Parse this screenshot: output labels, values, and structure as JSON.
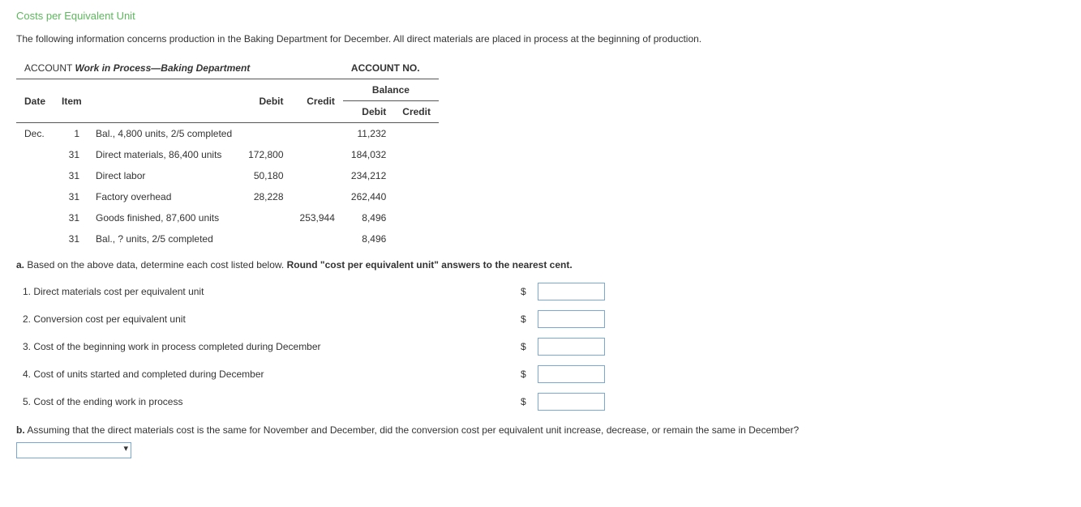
{
  "title": "Costs per Equivalent Unit",
  "intro": "The following information concerns production in the Baking Department for December. All direct materials are placed in process at the beginning of production.",
  "ledger": {
    "account_label": "ACCOUNT",
    "account_name": "Work in Process—Baking Department",
    "account_no_label": "ACCOUNT NO.",
    "headers": {
      "date": "Date",
      "item": "Item",
      "debit": "Debit",
      "credit": "Credit",
      "balance": "Balance",
      "bal_debit": "Debit",
      "bal_credit": "Credit"
    },
    "rows": [
      {
        "date": "Dec.",
        "day": "1",
        "item": "Bal., 4,800 units, 2/5 completed",
        "debit": "",
        "credit": "",
        "bal_debit": "11,232",
        "bal_credit": ""
      },
      {
        "date": "",
        "day": "31",
        "item": "Direct materials, 86,400 units",
        "debit": "172,800",
        "credit": "",
        "bal_debit": "184,032",
        "bal_credit": ""
      },
      {
        "date": "",
        "day": "31",
        "item": "Direct labor",
        "debit": "50,180",
        "credit": "",
        "bal_debit": "234,212",
        "bal_credit": ""
      },
      {
        "date": "",
        "day": "31",
        "item": "Factory overhead",
        "debit": "28,228",
        "credit": "",
        "bal_debit": "262,440",
        "bal_credit": ""
      },
      {
        "date": "",
        "day": "31",
        "item": "Goods finished, 87,600 units",
        "debit": "",
        "credit": "253,944",
        "bal_debit": "8,496",
        "bal_credit": ""
      },
      {
        "date": "",
        "day": "31",
        "item": "Bal., ? units, 2/5 completed",
        "debit": "",
        "credit": "",
        "bal_debit": "8,496",
        "bal_credit": ""
      }
    ]
  },
  "partA": {
    "prefix": "a.",
    "text_before": "Based on the above data, determine each cost listed below. ",
    "text_bold": "Round \"cost per equivalent unit\" answers to the nearest cent.",
    "items": [
      "1.  Direct materials cost per equivalent unit",
      "2.  Conversion cost per equivalent unit",
      "3.  Cost of the beginning work in process completed during December",
      "4.  Cost of units started and completed during December",
      "5.  Cost of the ending work in process"
    ],
    "currency": "$"
  },
  "partB": {
    "prefix": "b.",
    "text": "Assuming that the direct materials cost is the same for November and December, did the conversion cost per equivalent unit increase, decrease, or remain the same in December?"
  },
  "chart_data": {
    "type": "table",
    "title": "Work in Process—Baking Department",
    "columns": [
      "Date",
      "Item",
      "Debit",
      "Credit",
      "Balance Debit",
      "Balance Credit"
    ],
    "rows": [
      [
        "Dec. 1",
        "Bal., 4,800 units, 2/5 completed",
        null,
        null,
        11232,
        null
      ],
      [
        "Dec. 31",
        "Direct materials, 86,400 units",
        172800,
        null,
        184032,
        null
      ],
      [
        "Dec. 31",
        "Direct labor",
        50180,
        null,
        234212,
        null
      ],
      [
        "Dec. 31",
        "Factory overhead",
        28228,
        null,
        262440,
        null
      ],
      [
        "Dec. 31",
        "Goods finished, 87,600 units",
        null,
        253944,
        8496,
        null
      ],
      [
        "Dec. 31",
        "Bal., ? units, 2/5 completed",
        null,
        null,
        8496,
        null
      ]
    ]
  }
}
